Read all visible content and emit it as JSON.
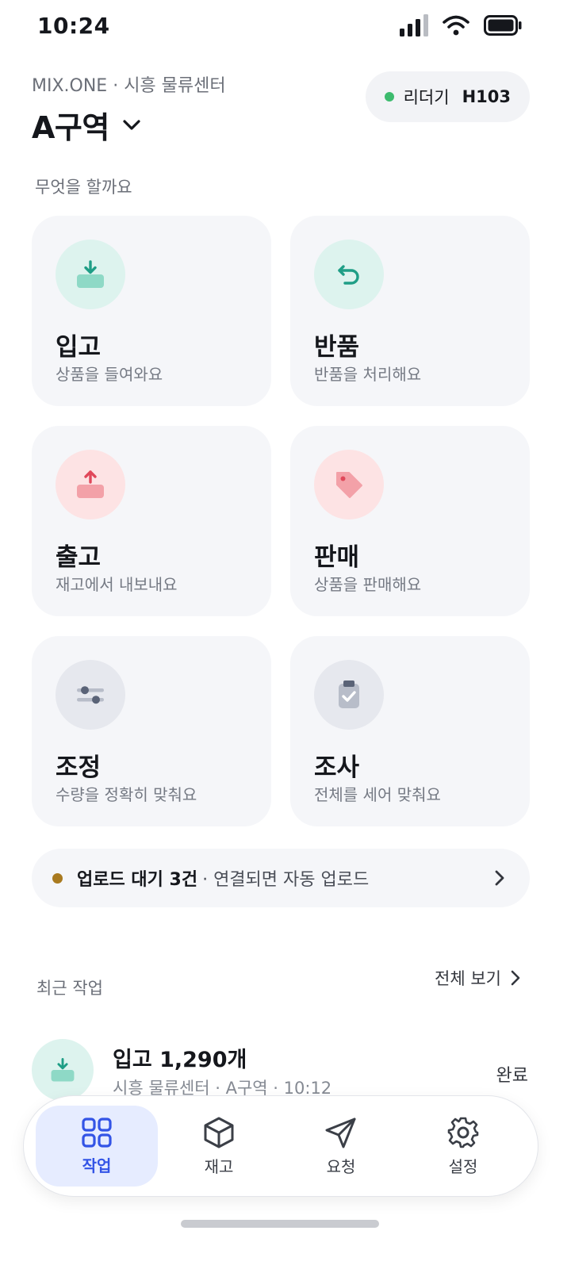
{
  "status_bar": {
    "time": "10:24"
  },
  "header": {
    "org_line": "MIX.ONE · 시흥 물류센터",
    "zone": "A구역",
    "device_label": "리더기",
    "device_id": "H103"
  },
  "section_actions": "무엇을 할까요",
  "tiles": [
    {
      "title": "입고",
      "subtitle": "상품을 들여와요",
      "icon": "inbound-icon",
      "color": "#1f9e86"
    },
    {
      "title": "반품",
      "subtitle": "반품을 처리해요",
      "icon": "return-icon",
      "color": "#1f9e86"
    },
    {
      "title": "출고",
      "subtitle": "재고에서 내보내요",
      "icon": "outbound-icon",
      "color": "#e0485a"
    },
    {
      "title": "판매",
      "subtitle": "상품을 판매해요",
      "icon": "sale-tag-icon",
      "color": "#e0485a"
    },
    {
      "title": "조정",
      "subtitle": "수량을 정확히 맞춰요",
      "icon": "sliders-icon",
      "color": "#5a6377"
    },
    {
      "title": "조사",
      "subtitle": "전체를 세어 맞춰요",
      "icon": "clipboard-check-icon",
      "color": "#5a6377"
    }
  ],
  "upload_banner": {
    "bold": "업로드 대기 3건",
    "rest": "· 연결되면 자동 업로드"
  },
  "recent": {
    "label": "최근 작업",
    "see_all": "전체 보기",
    "items": [
      {
        "title": "입고 1,290개",
        "subtitle": "시흥 물류센터 · A구역 · 10:12",
        "status": "완료"
      }
    ]
  },
  "tab_bar": {
    "tabs": [
      {
        "label": "작업",
        "icon": "grid-icon",
        "active": true
      },
      {
        "label": "재고",
        "icon": "box-icon",
        "active": false
      },
      {
        "label": "요청",
        "icon": "send-icon",
        "active": false
      },
      {
        "label": "설정",
        "icon": "gear-icon",
        "active": false
      }
    ]
  },
  "colors": {
    "accent": "#3354e6",
    "online": "#3dbb6e",
    "pending": "#a97a1f"
  }
}
